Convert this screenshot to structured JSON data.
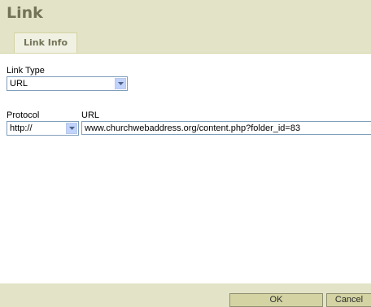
{
  "dialog": {
    "title": "Link"
  },
  "tabs": [
    {
      "label": "Link Info"
    }
  ],
  "link_type": {
    "label": "Link Type",
    "selected": "URL"
  },
  "protocol": {
    "label": "Protocol",
    "selected": "http://"
  },
  "url": {
    "label": "URL",
    "value": "www.churchwebaddress.org/content.php?folder_id=83"
  },
  "buttons": {
    "ok": "OK",
    "cancel": "Cancel"
  },
  "colors": {
    "header_bg": "#e3e3c7",
    "title_text": "#737357",
    "button_bg": "#d3d3a3",
    "dropdown_button": "#c1d3fb"
  }
}
